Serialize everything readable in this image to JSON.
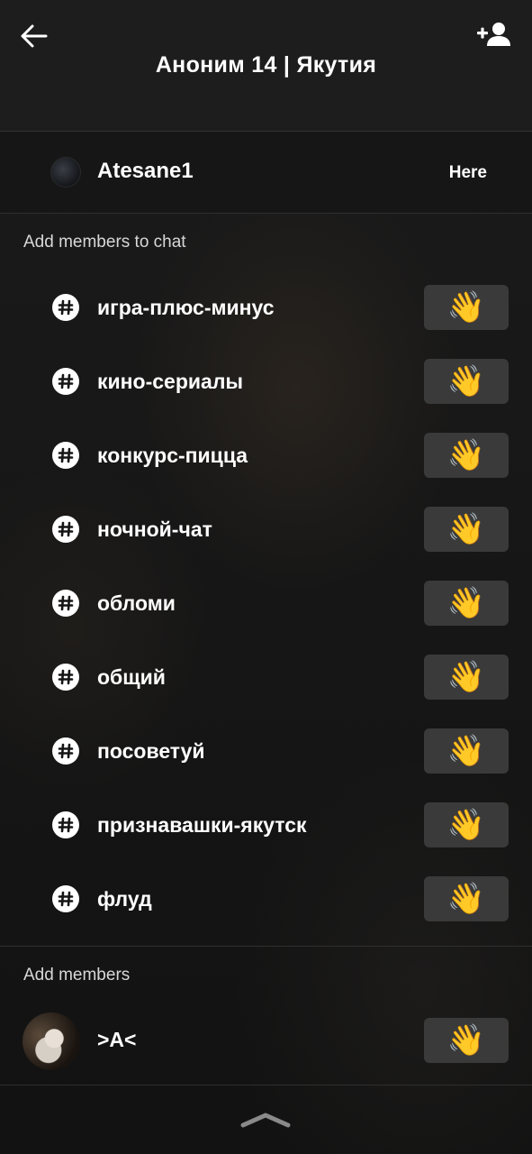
{
  "header": {
    "title": "Аноним 14 | Якутия",
    "back_icon": "arrow-left-icon",
    "add_user_icon": "add-person-icon"
  },
  "current_member": {
    "name": "Atesane1",
    "status": "Here"
  },
  "add_members_to_chat": {
    "label": "Add members to chat",
    "channels": [
      {
        "name": "игра-плюс-минус",
        "action": "👋"
      },
      {
        "name": "кино-сериалы",
        "action": "👋"
      },
      {
        "name": "конкурс-пицца",
        "action": "👋"
      },
      {
        "name": "ночной-чат",
        "action": "👋"
      },
      {
        "name": "обломи",
        "action": "👋"
      },
      {
        "name": "общий",
        "action": "👋"
      },
      {
        "name": "посоветуй",
        "action": "👋"
      },
      {
        "name": "признавашки-якутск",
        "action": "👋"
      },
      {
        "name": "флуд",
        "action": "👋"
      }
    ]
  },
  "add_members": {
    "label": "Add members",
    "users": [
      {
        "name": ">A<",
        "action": "👋"
      }
    ]
  },
  "colors": {
    "background": "#161616",
    "button": "#3a3a3a",
    "text": "#ffffff"
  }
}
